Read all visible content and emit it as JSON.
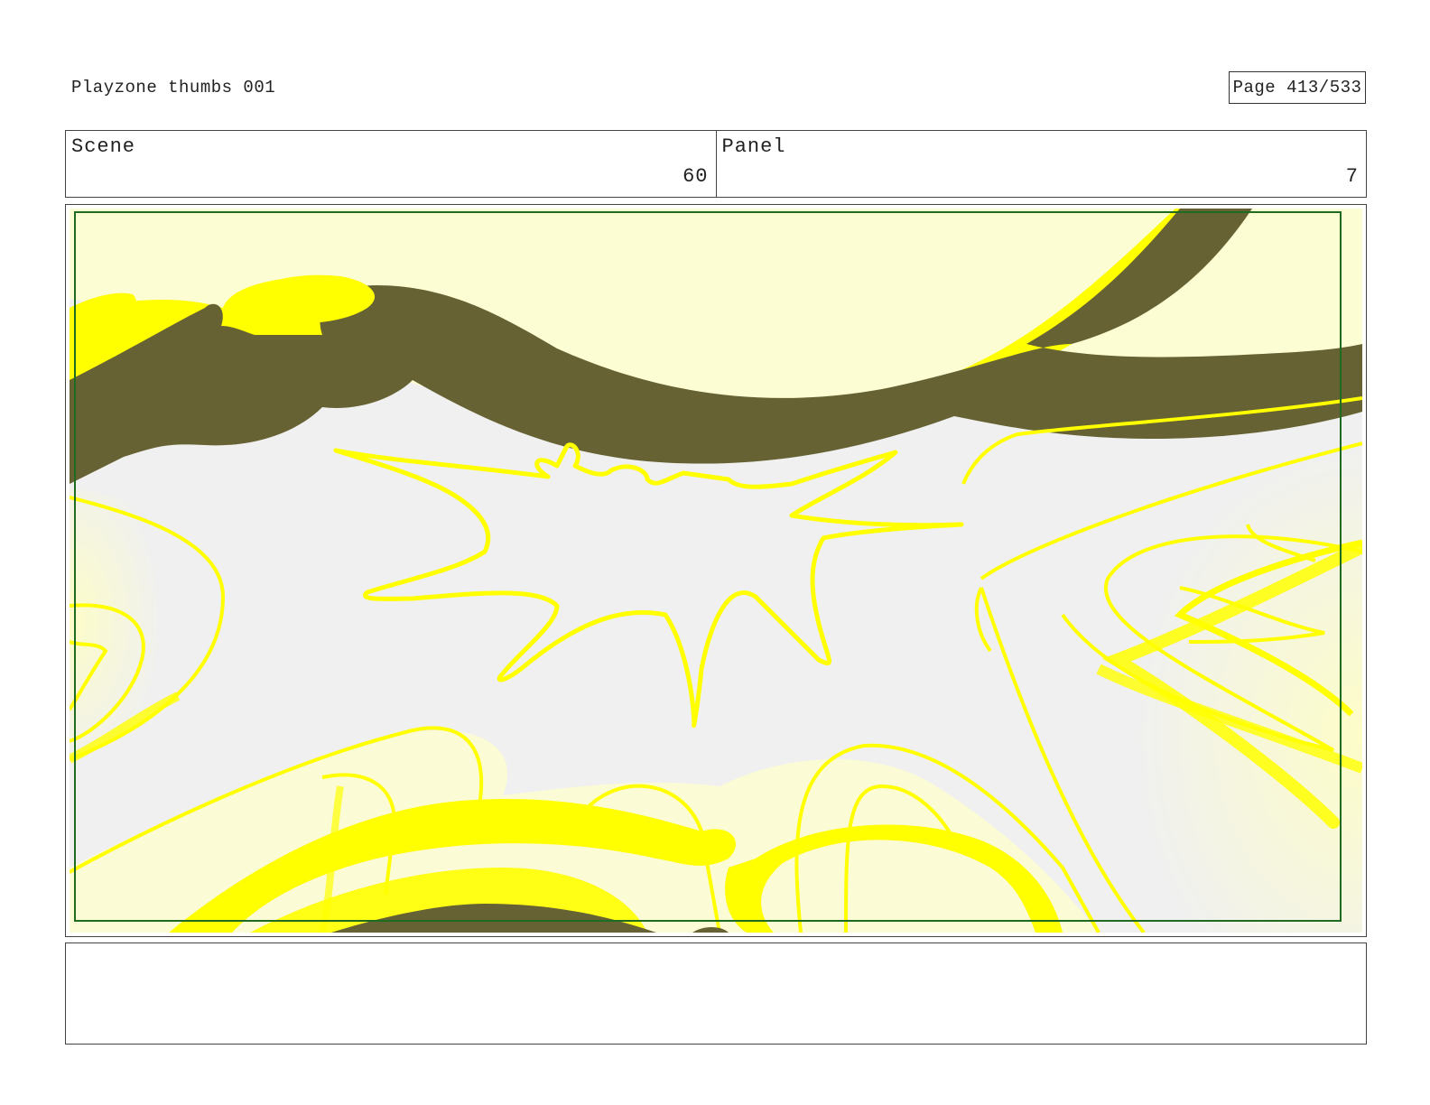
{
  "header": {
    "document_title": "Playzone thumbs 001",
    "page_indicator": "Page 413/533"
  },
  "scene": {
    "label": "Scene",
    "value": "60"
  },
  "panel": {
    "label": "Panel",
    "value": "7"
  },
  "artwork": {
    "description_icon": "storyboard-sketch",
    "colors": {
      "background": "#f0f0f0",
      "glow": "#fdfdd0",
      "yellow": "#ffff00",
      "dark_stroke": "#666233",
      "safe_frame": "#1f6b1f"
    }
  },
  "notes": {
    "text": ""
  }
}
